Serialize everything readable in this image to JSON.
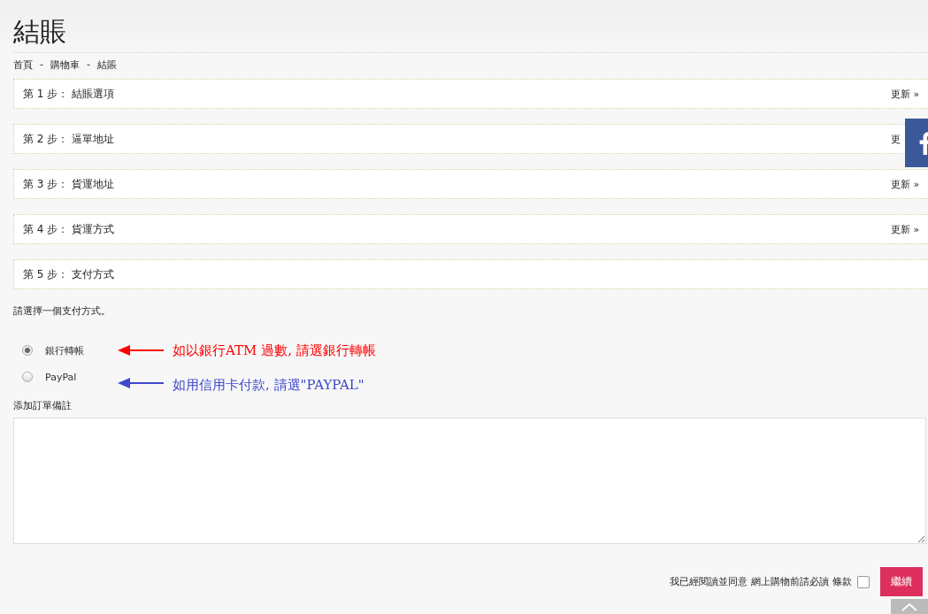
{
  "title": "結賬",
  "breadcrumb": [
    "首頁",
    "購物車",
    "結賬"
  ],
  "breadcrumb_separator": "-",
  "steps": [
    {
      "label": "第 1 步： 結賬選項",
      "link": "更新 »"
    },
    {
      "label": "第 2 步： 逼單地址",
      "link": "更"
    },
    {
      "label": "第 3 步： 貨運地址",
      "link": "更新 »"
    },
    {
      "label": "第 4 步： 貨運方式",
      "link": "更新 »"
    },
    {
      "label": "第 5 步： 支付方式"
    }
  ],
  "payment_prompt": "請選擇一個支付方式。",
  "payment_methods": [
    {
      "label": "銀行轉帳",
      "selected": true,
      "note": "如以銀行ATM 過數, 請選銀行轉帳",
      "color": "#ff0000"
    },
    {
      "label": "PayPal",
      "selected": false,
      "note": "如用信用卡付款, 請選\"PAYPAL\"",
      "color": "#3f48cc"
    }
  ],
  "comment_label": "添加訂單備註",
  "terms": {
    "prefix": "我已經閱讀並同意",
    "link": "網上購物前請必讀",
    "suffix": "條款",
    "checked": false
  },
  "continue_button": "繼續"
}
